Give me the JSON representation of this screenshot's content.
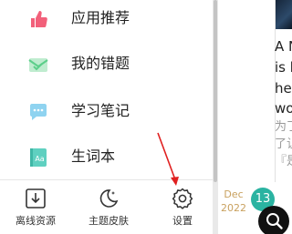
{
  "drawer": {
    "menu": [
      {
        "label": "应用推荐",
        "icon": "thumbs-up-icon"
      },
      {
        "label": "我的错题",
        "icon": "mail-check-icon"
      },
      {
        "label": "学习笔记",
        "icon": "note-bubble-icon"
      },
      {
        "label": "生词本",
        "icon": "vocabulary-book-icon"
      }
    ],
    "bottom": [
      {
        "label": "离线资源",
        "icon": "download-icon"
      },
      {
        "label": "主题皮肤",
        "icon": "moon-stars-icon"
      },
      {
        "label": "设置",
        "icon": "gear-icon"
      }
    ]
  },
  "content": {
    "lines_en": [
      "A N",
      "is b",
      "her",
      "wo"
    ],
    "lines_cn": [
      "为了",
      "了让",
      "『是"
    ],
    "date": {
      "month": "Dec",
      "year": "2022"
    },
    "badge": "13"
  },
  "colors": {
    "accent_pink": "#f2607a",
    "accent_green": "#5ccf8a",
    "accent_teal": "#2ab3a1",
    "annotation_red": "#e02020"
  }
}
